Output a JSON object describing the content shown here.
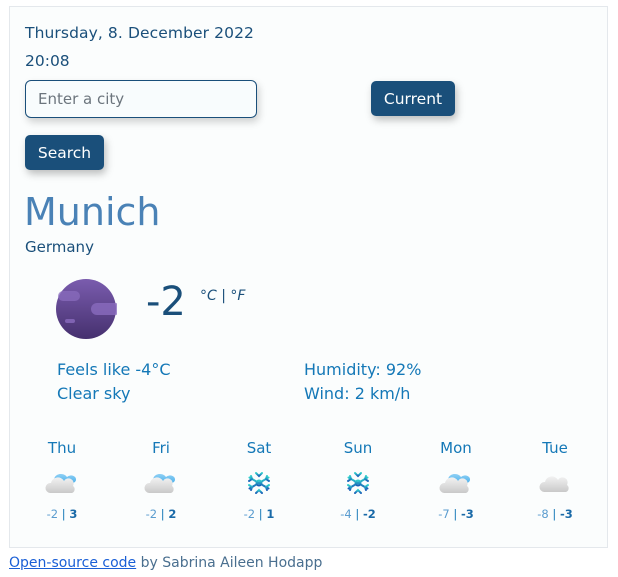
{
  "header": {
    "date": "Thursday, 8. December 2022",
    "time": "20:08"
  },
  "search": {
    "placeholder": "Enter a city",
    "value": "",
    "search_label": "Search",
    "current_label": "Current"
  },
  "location": {
    "city": "Munich",
    "country": "Germany"
  },
  "current": {
    "icon": "clear-night-icon",
    "temperature": "-2",
    "unit_celsius": "°C",
    "unit_separator": "|",
    "unit_fahrenheit": "°F",
    "feels_like": "Feels like -4°C",
    "description": "Clear sky",
    "humidity": "Humidity: 92%",
    "wind": "Wind: 2 km/h"
  },
  "forecast": [
    {
      "day": "Thu",
      "icon": "cloudy-icon",
      "min": "-2",
      "sep": "|",
      "max": "3"
    },
    {
      "day": "Fri",
      "icon": "cloudy-icon",
      "min": "-2",
      "sep": "|",
      "max": "2"
    },
    {
      "day": "Sat",
      "icon": "snow-icon",
      "min": "-2",
      "sep": "|",
      "max": "1"
    },
    {
      "day": "Sun",
      "icon": "snow-icon",
      "min": "-4",
      "sep": "|",
      "max": "-2"
    },
    {
      "day": "Mon",
      "icon": "cloudy-icon",
      "min": "-7",
      "sep": "|",
      "max": "-3"
    },
    {
      "day": "Tue",
      "icon": "overcast-icon",
      "min": "-8",
      "sep": "|",
      "max": "-3"
    }
  ],
  "footer": {
    "link_text": "Open-source code",
    "credit": " by Sabrina Aileen Hodapp"
  }
}
